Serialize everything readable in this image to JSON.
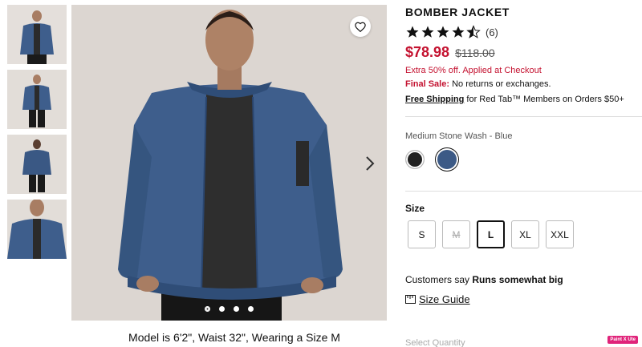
{
  "product": {
    "title": "BOMBER JACKET",
    "review_count": "(6)",
    "rating": 4.5,
    "sale_price": "$78.98",
    "original_price": "$118.00",
    "promo": "Extra 50% off. Applied at Checkout",
    "final_sale_label": "Final Sale:",
    "final_sale_text": "No returns or exchanges.",
    "shipping_link": "Free Shipping",
    "shipping_text": "for Red Tab™ Members on Orders $50+",
    "color_name": "Medium Stone Wash - Blue",
    "size_label": "Size",
    "sizes": [
      "S",
      "M",
      "L",
      "XL",
      "XXL"
    ],
    "selected_size": "L",
    "unavailable_size": "M",
    "fit_prefix": "Customers say",
    "fit_value": "Runs somewhat big",
    "size_guide": "Size Guide",
    "select_quantity": "Select Quantity"
  },
  "gallery": {
    "caption": "Model is 6'2\", Waist 32\", Wearing a Size M",
    "thumb_count": 4,
    "dot_count": 4,
    "active_dot": 0
  },
  "badge": "Paint X Ute",
  "colors": {
    "sale": "#c41230",
    "denim": "#3c5a86"
  }
}
